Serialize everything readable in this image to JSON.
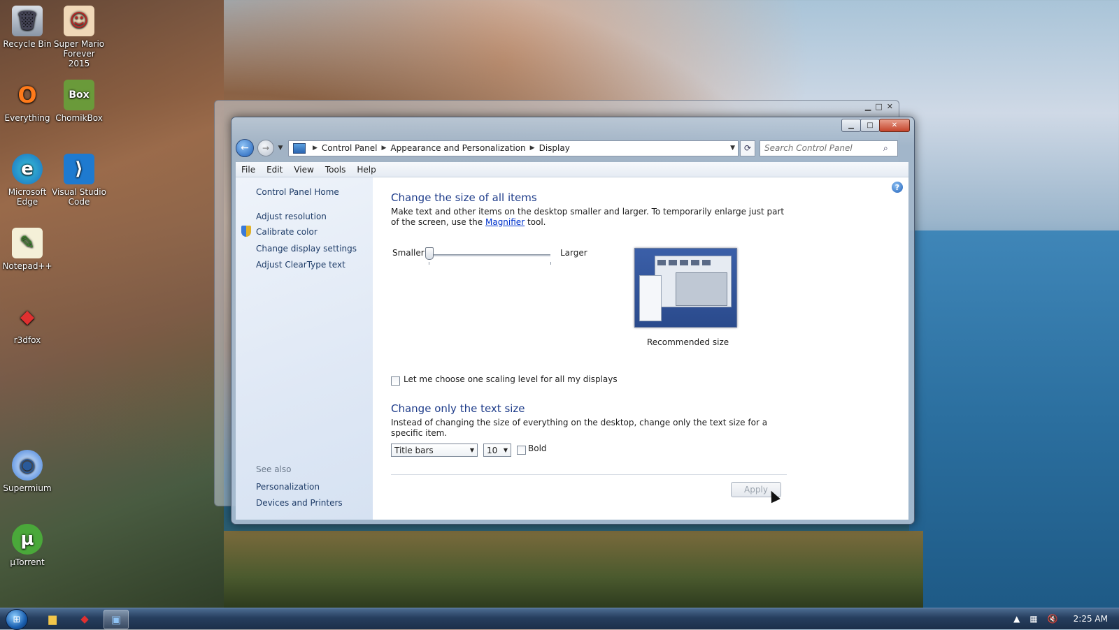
{
  "desktop": {
    "icons": [
      {
        "label": "Recycle Bin",
        "glyph": "🗑"
      },
      {
        "label": "Super Mario Forever 2015",
        "glyph": "☺"
      },
      {
        "label": "Everything",
        "glyph": "O"
      },
      {
        "label": "ChomikBox",
        "glyph": "Box"
      },
      {
        "label": "Microsoft Edge",
        "glyph": "e"
      },
      {
        "label": "Visual Studio Code",
        "glyph": "⟩"
      },
      {
        "label": "Notepad++",
        "glyph": "✎"
      },
      {
        "label": "r3dfox",
        "glyph": "◆"
      },
      {
        "label": "Supermium",
        "glyph": "◉"
      },
      {
        "label": "µTorrent",
        "glyph": "µ"
      }
    ]
  },
  "window": {
    "address": {
      "crumbs": [
        "Control Panel",
        "Appearance and Personalization",
        "Display"
      ]
    },
    "search_placeholder": "Search Control Panel",
    "menu": [
      "File",
      "Edit",
      "View",
      "Tools",
      "Help"
    ],
    "sidebar": {
      "home": "Control Panel Home",
      "links": [
        "Adjust resolution",
        "Calibrate color",
        "Change display settings",
        "Adjust ClearType text"
      ],
      "see_also_label": "See also",
      "see_also": [
        "Personalization",
        "Devices and Printers"
      ]
    },
    "main": {
      "heading1": "Change the size of all items",
      "desc1_part1": "Make text and other items on the desktop smaller and larger. To temporarily enlarge just part of the screen, use the ",
      "desc1_link": "Magnifier",
      "desc1_part2": " tool.",
      "slider_min_label": "Smaller",
      "slider_max_label": "Larger",
      "slider_value": 0,
      "preview_caption": "Recommended size",
      "scaling_checkbox_label": "Let me choose one scaling level for all my displays",
      "heading2": "Change only the text size",
      "desc2": "Instead of changing the size of everything on the desktop, change only the text size for a specific item.",
      "item_select": "Title bars",
      "size_select": "10",
      "bold_label": "Bold",
      "apply_label": "Apply"
    }
  },
  "taskbar": {
    "time": "2:25 AM"
  }
}
